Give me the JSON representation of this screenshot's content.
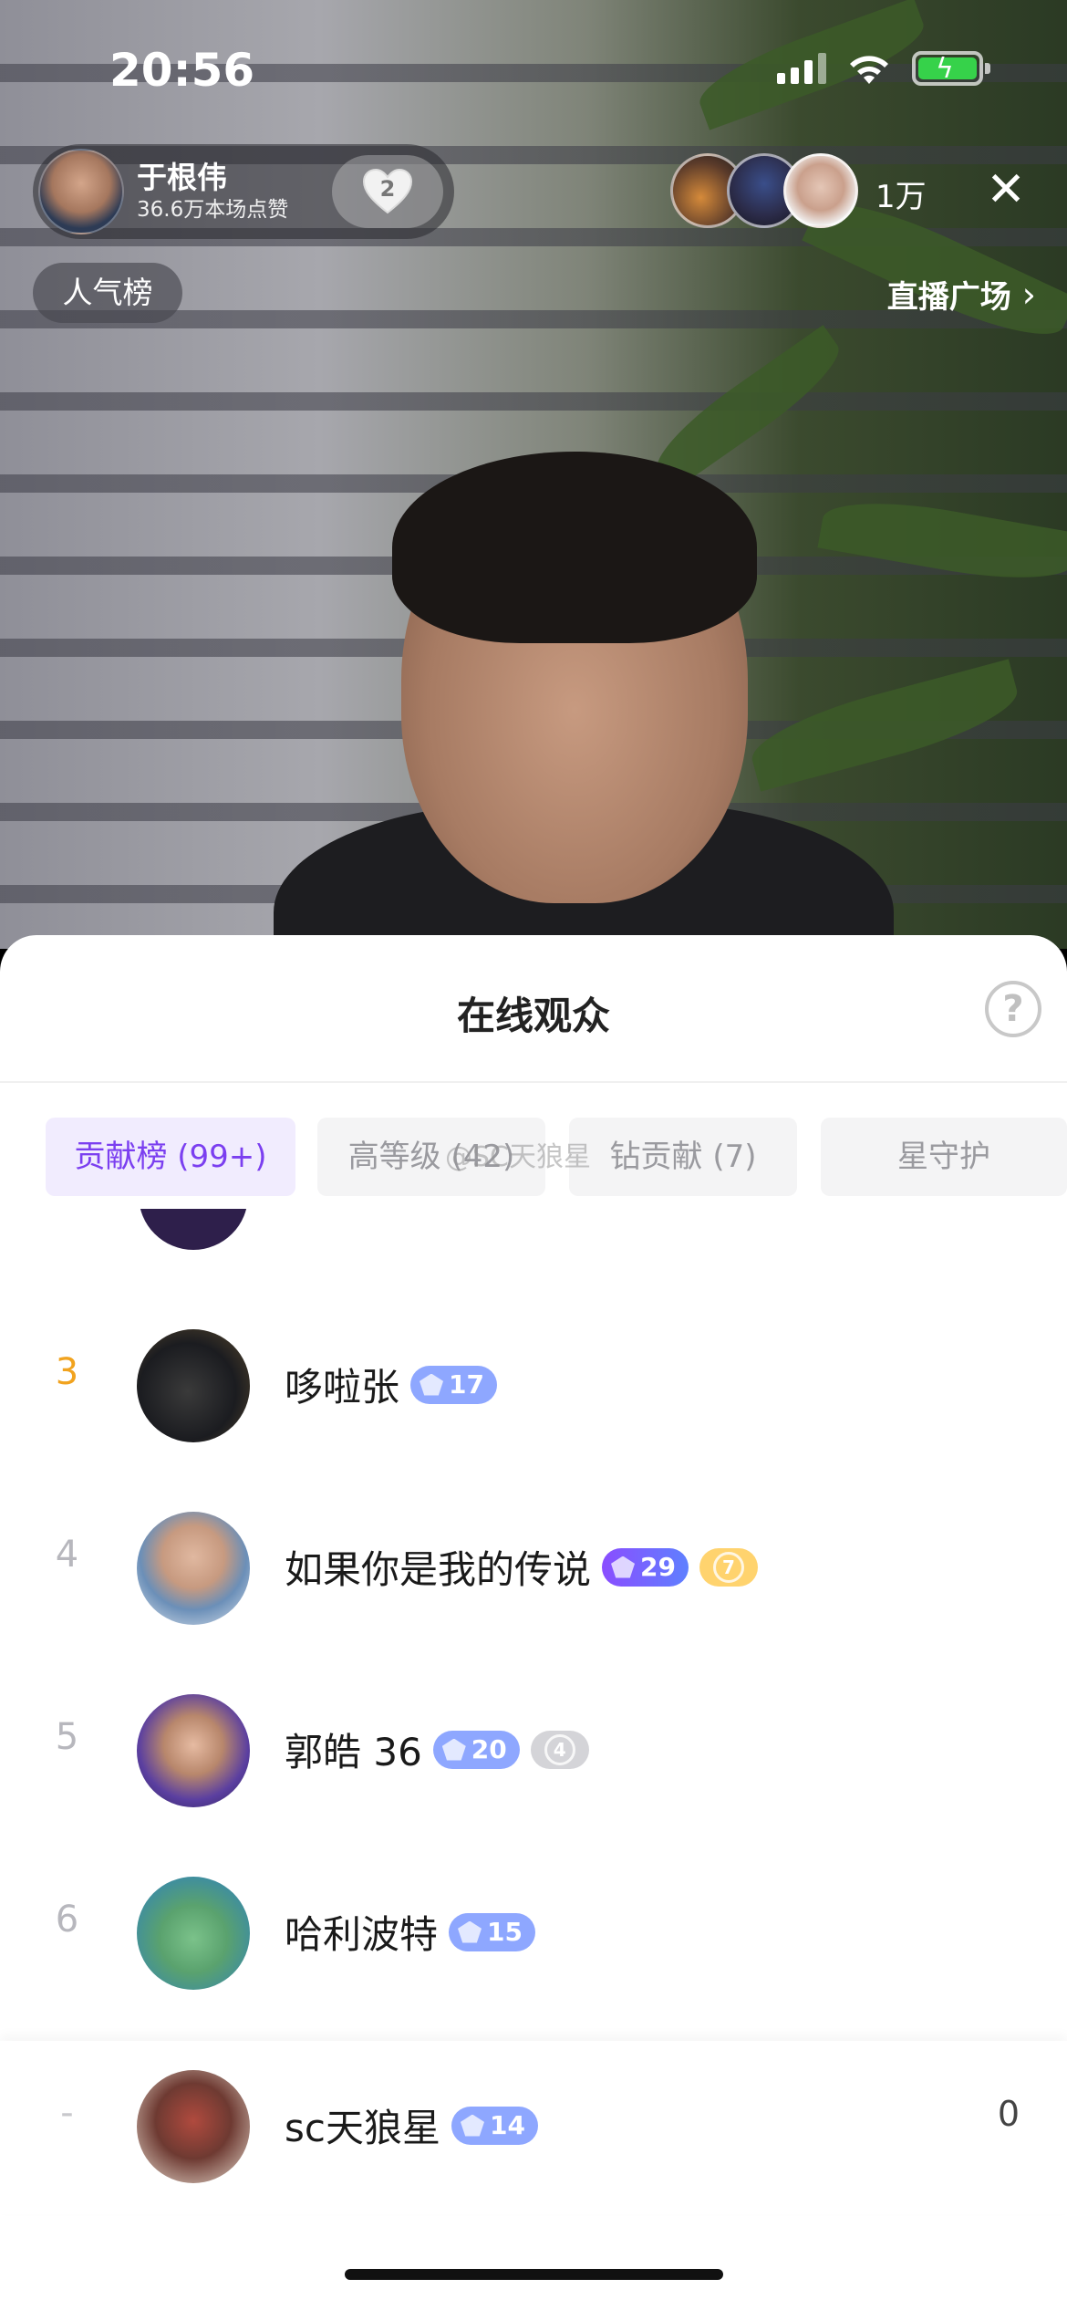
{
  "status_bar": {
    "time": "20:56"
  },
  "host": {
    "name": "于根伟",
    "likes": "36.6万本场点赞",
    "like_badge": "2"
  },
  "viewers": {
    "count": "1万"
  },
  "popularity_tag": "人气榜",
  "live_plaza": {
    "label": "直播广场",
    "chevron": "›"
  },
  "sheet": {
    "title": "在线观众",
    "help": "?",
    "tabs": [
      {
        "label": "贡献榜 (99+)",
        "active": true
      },
      {
        "label": "高等级 (42)",
        "active": false
      },
      {
        "label": "钻贡献 (7)",
        "active": false
      },
      {
        "label": "星守护",
        "active": false
      }
    ],
    "watermark": "@SC天狼星"
  },
  "ranking": [
    {
      "rank": "3",
      "name": "哆啦张",
      "level": "17"
    },
    {
      "rank": "4",
      "name": "如果你是我的传说",
      "level": "29",
      "badge": "7"
    },
    {
      "rank": "5",
      "name": "郭皓 36",
      "level": "20",
      "badge": "4"
    },
    {
      "rank": "6",
      "name": "哈利波特",
      "level": "15"
    }
  ],
  "self_row": {
    "rank": "-",
    "name": "sc天狼星",
    "level": "14",
    "score": "0"
  },
  "colors": {
    "accent": "#7b3ff0",
    "gold_rank": "#f1a31f",
    "level_badge": "#8ea7ff",
    "sheet_bg": "#ffffff"
  }
}
